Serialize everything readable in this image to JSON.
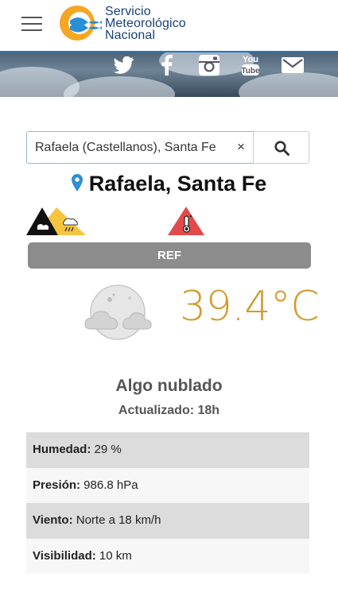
{
  "header": {
    "logo_line1": "Servicio",
    "logo_line2": "Meteorológico",
    "logo_line3": "Nacional",
    "brand_color": "#17427a",
    "accent_color": "#1d79c4",
    "logo_sun_color": "#f5a623"
  },
  "social": [
    "twitter-icon",
    "facebook-icon",
    "instagram-icon",
    "youtube-icon",
    "mail-icon"
  ],
  "search": {
    "value": "Rafaela (Castellanos), Santa Fe",
    "clear_label": "×"
  },
  "location": {
    "name": "Rafaela, Santa Fe"
  },
  "alerts": [
    {
      "icon": "snow-storm-alert-icon",
      "color": "#f5c542"
    },
    {
      "icon": "high-temperature-alert-icon",
      "color": "#e14b4b"
    }
  ],
  "ref_label": "REF",
  "current": {
    "temperature": "39.4°C",
    "condition": "Algo nublado",
    "updated": "Actualizado: 18h",
    "temp_color": "#d39a2c"
  },
  "details": [
    {
      "label": "Humedad:",
      "value": " 29 %"
    },
    {
      "label": "Presión:",
      "value": " 986.8 hPa"
    },
    {
      "label": "Viento:",
      "value": " Norte a 18 km/h"
    },
    {
      "label": "Visibilidad:",
      "value": " 10 km"
    }
  ]
}
